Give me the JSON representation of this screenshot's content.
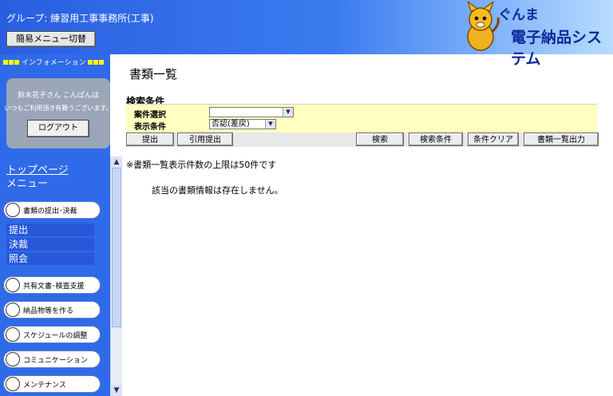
{
  "header": {
    "group_label": "グループ: 練習用工事事務所(工事)",
    "simple_menu_button": "簡易メニュー切替",
    "logo_line1": "ぐんま",
    "logo_line2": "電子納品システム"
  },
  "sidebar": {
    "info_label": "インフォメーション",
    "welcome_line1": "鈴木花子さん こんばんは",
    "welcome_line2": "いつもご利用頂き有難うございます。",
    "logout_button": "ログアウト",
    "top_page": "トップページ",
    "menu_title": "メニュー",
    "menu_items": [
      {
        "label": "書類の提出･決裁"
      },
      {
        "label": "共有文書･検査支援"
      },
      {
        "label": "納品物等を作る"
      },
      {
        "label": "スケジュールの調整"
      },
      {
        "label": "コミュニケーション"
      },
      {
        "label": "メンテナンス"
      }
    ],
    "sub_items": [
      "提出",
      "決裁",
      "照会"
    ]
  },
  "main": {
    "title": "書類一覧",
    "search_header": "検索条件",
    "case_label": "案件選択",
    "case_value": "",
    "display_label": "表示条件",
    "display_value": "否認(差戻)",
    "buttons": {
      "submit": "提出",
      "cite_submit": "引用提出",
      "search": "検索",
      "search_conditions": "検索条件",
      "clear_conditions": "条件クリア",
      "list_output": "書類一覧出力"
    },
    "note": "※書類一覧表示件数の上限は50件です",
    "empty_message": "該当の書類情報は存在しません。"
  }
}
